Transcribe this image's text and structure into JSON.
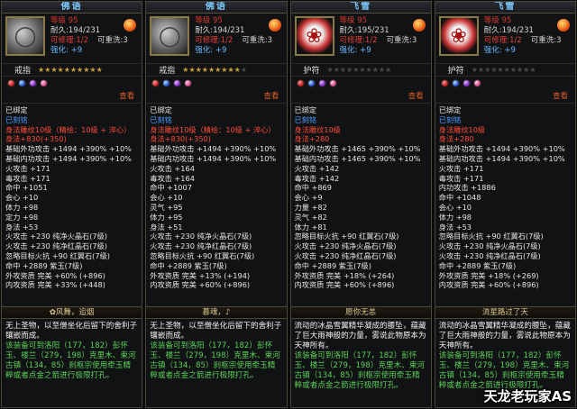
{
  "panels": [
    {
      "title": "佛语",
      "level": "等级 95",
      "durability": "耐久:194/231",
      "repair": "可修理:1/2",
      "reforge": "可重洗:3",
      "enhance": "强化: +9",
      "icon": "ring-icon",
      "type": "戒指",
      "stars_on": 10,
      "stars_total": 10,
      "gems": [
        "red",
        "blue",
        "purple",
        "pink"
      ],
      "view": "查看",
      "bound": "已绑定",
      "engraved": "已刻铭",
      "lines": [
        {
          "t": "身法雕纹10级（精绘：10级 + 淬心）",
          "c": "r"
        },
        {
          "t": "身法+830(+350)",
          "c": "r"
        },
        {
          "t": "基础外功攻击 +1494 +390% +10%",
          "c": "w"
        },
        {
          "t": "基础内功攻击 +1494 +390% +10%",
          "c": "w"
        },
        {
          "t": "火攻击 +171",
          "c": "w"
        },
        {
          "t": "毒攻击 +171",
          "c": "w"
        },
        {
          "t": "命中 +1051",
          "c": "w"
        },
        {
          "t": "会心 +10",
          "c": "w"
        },
        {
          "t": "体力 +98",
          "c": "w"
        },
        {
          "t": "定力 +98",
          "c": "w"
        },
        {
          "t": "身法 +53",
          "c": "w"
        },
        {
          "t": "火攻击 +230 纯净火晶石(7级)",
          "c": "w"
        },
        {
          "t": "火攻击 +230 纯净红晶石(7级)",
          "c": "w"
        },
        {
          "t": "忽略目标火抗 +90 红翼石(7级)",
          "c": "w"
        },
        {
          "t": "命中 +2889 紫玉(7级)",
          "c": "w"
        },
        {
          "t": "外攻资质   完美 +60% (+896)",
          "c": "w"
        },
        {
          "t": "内攻资质   完美 +33% (+448)",
          "c": "w"
        }
      ],
      "banner": "✿风舞，追烟",
      "desc_intro": "无上圣物，以至僧坐化后留下的舍利子镶嵌而成。",
      "desc_set": "该装备可到洛阳（177，182）彭怀玉、楼兰（279，198）克里木、束河古镇（134，85）刹枢宗使用牵玉精粹或者点金之箭进行极限打孔。"
    },
    {
      "title": "佛语",
      "level": "等级 95",
      "durability": "耐久:194/231",
      "repair": "可修理:1/2",
      "reforge": "可重洗:3",
      "enhance": "强化: +9",
      "icon": "ring-icon",
      "type": "戒指",
      "stars_on": 9,
      "stars_total": 10,
      "gems": [
        "red",
        "blue",
        "purple",
        "pink"
      ],
      "view": "查看",
      "bound": "已绑定",
      "engraved": "已刻铭",
      "lines": [
        {
          "t": "身法雕纹10级（精绘：10级 + 淬心）",
          "c": "r"
        },
        {
          "t": "身法+830(+350)",
          "c": "r"
        },
        {
          "t": "基础外功攻击 +1494 +390% +10%",
          "c": "w"
        },
        {
          "t": "基础内功攻击 +1494 +390% +10%",
          "c": "w"
        },
        {
          "t": "火攻击 +164",
          "c": "w"
        },
        {
          "t": "毒攻击 +164",
          "c": "w"
        },
        {
          "t": "命中 +1007",
          "c": "w"
        },
        {
          "t": "会心 +10",
          "c": "w"
        },
        {
          "t": "灵气 +95",
          "c": "w"
        },
        {
          "t": "体力 +95",
          "c": "w"
        },
        {
          "t": "身法 +51",
          "c": "w"
        },
        {
          "t": "火攻击 +230 纯净火晶石(7级)",
          "c": "w"
        },
        {
          "t": "火攻击 +230 纯净红晶石(7级)",
          "c": "w"
        },
        {
          "t": "忽略目标火抗 +90 红翼石(7级)",
          "c": "w"
        },
        {
          "t": "命中 +2889 紫玉(7级)",
          "c": "w"
        },
        {
          "t": "外攻资质   完美 +13% (+194)",
          "c": "w"
        },
        {
          "t": "内攻资质   完美 +60% (+896)",
          "c": "w"
        }
      ],
      "banner": "慕魂，♪",
      "desc_intro": "无上圣物，以至僧坐化后留下的舍利子镶嵌而成。",
      "desc_set": "该装备可到洛阳（177，182）彭怀玉、楼兰（279，198）克里木、束河古镇（134，85）刹枢宗使用牵玉精粹或者点金之箭进行极限打孔。"
    },
    {
      "title": "飞雪",
      "level": "等级 95",
      "durability": "耐久:195/231",
      "repair": "可修理:1/2",
      "reforge": "可重洗:3",
      "enhance": "强化: +9",
      "icon": "amulet-icon",
      "type": "护符",
      "stars_on": 0,
      "stars_total": 10,
      "gems": [
        "red",
        "blue",
        "purple",
        "pink"
      ],
      "view": "查看",
      "bound": "已绑定",
      "engraved": "已刻铭",
      "lines": [
        {
          "t": "身法雕纹10级",
          "c": "r"
        },
        {
          "t": "身法+280",
          "c": "r"
        },
        {
          "t": "基础外功攻击 +1465 +390% +10%",
          "c": "w"
        },
        {
          "t": "基础内功攻击 +1465 +390% +10%",
          "c": "w"
        },
        {
          "t": "火攻击 +142",
          "c": "w"
        },
        {
          "t": "毒攻击 +142",
          "c": "w"
        },
        {
          "t": "命中 +869",
          "c": "w"
        },
        {
          "t": "会心 +9",
          "c": "w"
        },
        {
          "t": "力量 +82",
          "c": "w"
        },
        {
          "t": "灵气 +82",
          "c": "w"
        },
        {
          "t": "体力 +81",
          "c": "w"
        },
        {
          "t": "忽略目标火抗 +90 红翼石(7级)",
          "c": "w"
        },
        {
          "t": "火攻击 +230 纯净火晶石(7级)",
          "c": "w"
        },
        {
          "t": "火攻击 +230 纯净红晶石(7级)",
          "c": "w"
        },
        {
          "t": "命中 +2889 紫玉(7级)",
          "c": "w"
        },
        {
          "t": "外攻资质   完美 +18% (+264)",
          "c": "w"
        },
        {
          "t": "内攻资质   完美 +60% (+896)",
          "c": "w"
        }
      ],
      "banner": "愿你无恙",
      "desc_intro": "流动的冰晶雪翼精华凝成的腰坠，蕴藏了巨大雨神般的力量，雾说此物原本为天神所有。",
      "desc_set": "该装备可到洛阳（177，182）彭怀玉、楼兰（279，198）克里木、束河古镇（134，85）刹枢宗使用牵玉精粹或者点金之箭进行极限打孔。"
    },
    {
      "title": "飞雪",
      "level": "等级 95",
      "durability": "耐久:194/231",
      "repair": "可修理:1/2",
      "reforge": "可重洗:3",
      "enhance": "强化: +9",
      "icon": "amulet-icon",
      "type": "护符",
      "stars_on": 0,
      "stars_total": 10,
      "gems": [
        "red",
        "blue",
        "purple",
        "pink"
      ],
      "view": "查看",
      "bound": "已绑定",
      "engraved": "已刻铭",
      "lines": [
        {
          "t": "身法雕纹10级",
          "c": "r"
        },
        {
          "t": "身法+280",
          "c": "r"
        },
        {
          "t": "基础外功攻击 +1494 +390% +10%",
          "c": "w"
        },
        {
          "t": "基础内功攻击 +1494 +390% +10%",
          "c": "w"
        },
        {
          "t": "火攻击 +171",
          "c": "w"
        },
        {
          "t": "毒攻击 +171",
          "c": "w"
        },
        {
          "t": "内功攻击 +1886",
          "c": "w"
        },
        {
          "t": "命中 +1048",
          "c": "w"
        },
        {
          "t": "会心 +10",
          "c": "w"
        },
        {
          "t": "体力 +98",
          "c": "w"
        },
        {
          "t": "身法 +53",
          "c": "w"
        },
        {
          "t": "忽略目标火抗 +90 红翼石(7级)",
          "c": "w"
        },
        {
          "t": "火攻击 +230 纯净火晶石(7级)",
          "c": "w"
        },
        {
          "t": "火攻击 +230 纯净红晶石(7级)",
          "c": "w"
        },
        {
          "t": "命中 +2889 紫玉(7级)",
          "c": "w"
        },
        {
          "t": "外攻资质   完美 +18% (+269)",
          "c": "w"
        },
        {
          "t": "内攻资质   完美 +60% (+896)",
          "c": "w"
        }
      ],
      "banner": "流星路过了天",
      "desc_intro": "流动的冰晶雪翼精华凝成的腰坠，蕴藏了巨大雨神般的力量，雾说此物原本为天神所有。",
      "desc_set": "该装备可到洛阳（177，182）彭怀玉、楼兰（279，198）克里木、束河古镇（134，85）刹枢宗使用牵玉精粹或者点金之箭进行极限打孔。"
    }
  ],
  "watermark": "天龙老玩家AS"
}
